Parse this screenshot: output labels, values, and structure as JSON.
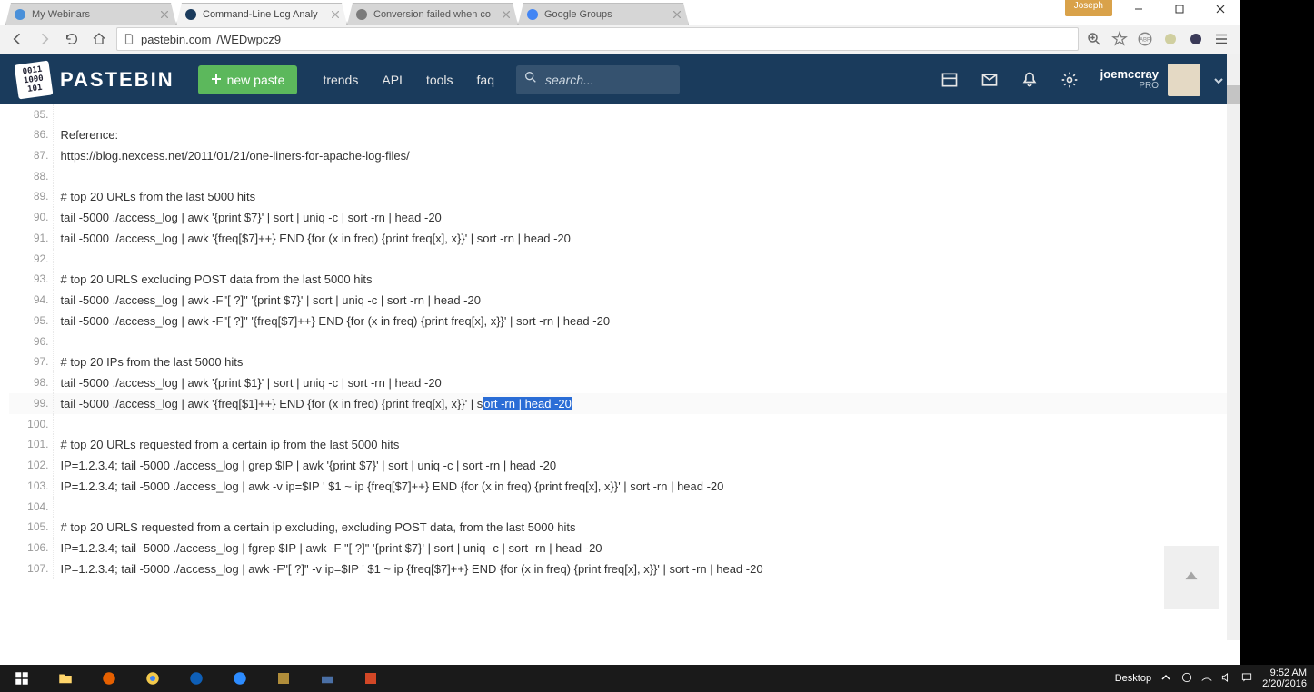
{
  "window": {
    "user_badge": "Joseph",
    "tabs": [
      {
        "title": "My Webinars",
        "active": false
      },
      {
        "title": "Command-Line Log Analy",
        "active": true
      },
      {
        "title": "Conversion failed when co",
        "active": false
      },
      {
        "title": "Google Groups",
        "active": false
      }
    ]
  },
  "toolbar": {
    "url_domain": "pastebin.com",
    "url_path": "/WEDwpcz9"
  },
  "pastebin": {
    "logo_badge": "0011\n1000\n101",
    "logo_text": "PASTEBIN",
    "new_paste": "new paste",
    "nav": {
      "trends": "trends",
      "api": "API",
      "tools": "tools",
      "faq": "faq"
    },
    "search_placeholder": "search...",
    "user": {
      "name": "joemccray",
      "pro": "PRO"
    }
  },
  "paste": {
    "start_num": 85,
    "lines": [
      "",
      "Reference:",
      "https://blog.nexcess.net/2011/01/21/one-liners-for-apache-log-files/",
      "",
      "# top 20 URLs from the last 5000 hits",
      "tail -5000 ./access_log | awk '{print $7}' | sort | uniq -c | sort -rn | head -20",
      "tail -5000 ./access_log | awk '{freq[$7]++} END {for (x in freq) {print freq[x], x}}' | sort -rn | head -20",
      "",
      "# top 20 URLS excluding POST data from the last 5000 hits",
      "tail -5000 ./access_log | awk -F\"[ ?]\" '{print $7}' | sort | uniq -c | sort -rn | head -20",
      "tail -5000 ./access_log | awk -F\"[ ?]\" '{freq[$7]++} END {for (x in freq) {print freq[x], x}}' | sort -rn | head -20",
      "",
      "# top 20 IPs from the last 5000 hits",
      "tail -5000 ./access_log | awk '{print $1}' | sort | uniq -c | sort -rn | head -20",
      "tail -5000 ./access_log | awk '{freq[$1]++} END {for (x in freq) {print freq[x], x}}' | sort -rn | head -20",
      "",
      "# top 20 URLs requested from a certain ip from the last 5000 hits",
      "IP=1.2.3.4; tail -5000 ./access_log | grep $IP | awk '{print $7}' | sort | uniq -c | sort -rn | head -20",
      "IP=1.2.3.4; tail -5000 ./access_log | awk -v ip=$IP ' $1 ~ ip {freq[$7]++} END {for (x in freq) {print freq[x], x}}' | sort -rn | head -20",
      "",
      "# top 20 URLS requested from a certain ip excluding, excluding POST data, from the last 5000 hits",
      "IP=1.2.3.4; tail -5000 ./access_log | fgrep $IP | awk -F \"[ ?]\" '{print $7}' | sort | uniq -c | sort -rn | head -20",
      "IP=1.2.3.4; tail -5000 ./access_log | awk -F\"[ ?]\" -v ip=$IP ' $1 ~ ip {freq[$7]++} END {for (x in freq) {print freq[x], x}}' | sort -rn | head -20"
    ],
    "highlighted_line_index": 14,
    "highlighted_prefix": "tail -5000 ./access_log | awk '{freq[$1]++} END {for (x in freq) {print freq[x], x}}' | s",
    "highlighted_selection": "ort -rn | head -20"
  },
  "taskbar": {
    "desktop_label": "Desktop",
    "time": "9:52 AM",
    "date": "2/20/2016"
  }
}
